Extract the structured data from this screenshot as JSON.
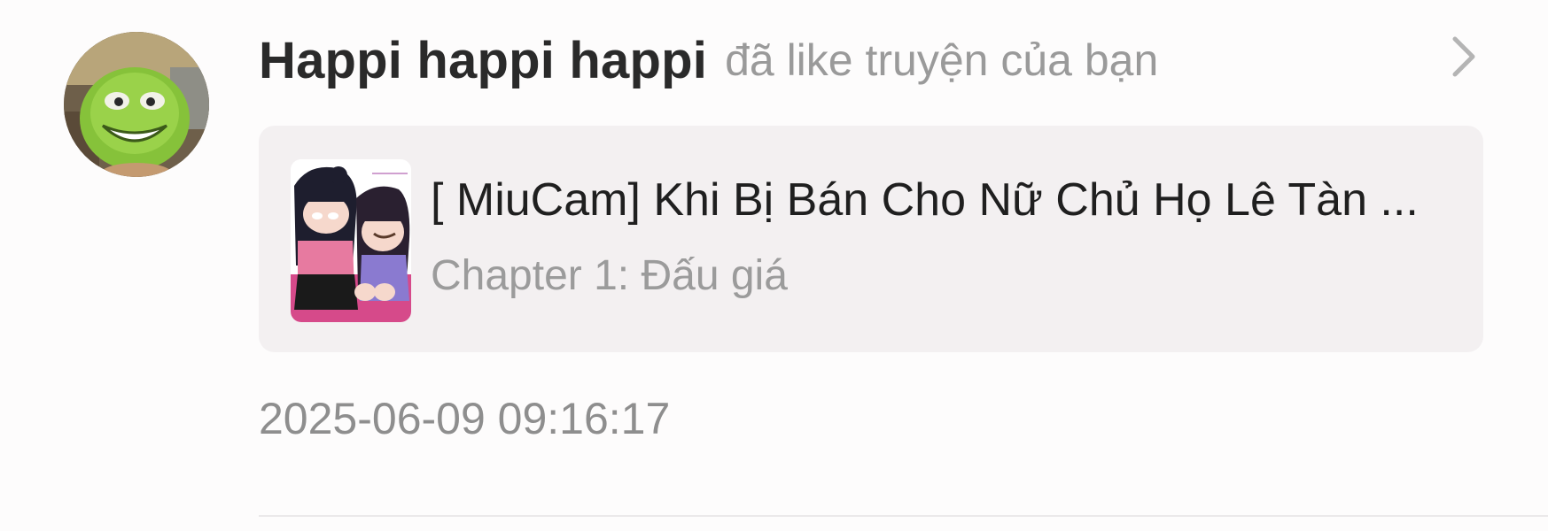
{
  "notification": {
    "username": "Happi happi happi",
    "action": "đã like truyện của bạn",
    "story": {
      "title": "[ MiuCam] Khi Bị Bán Cho Nữ Chủ Họ Lê Tàn ...",
      "chapter": "Chapter 1: Đấu giá"
    },
    "timestamp": "2025-06-09 09:16:17"
  },
  "icons": {
    "avatar": "green-one-eyed-monster-avatar",
    "open": "chevron-right-icon"
  },
  "colors": {
    "card_background": "#f3f0f1",
    "secondary_text": "#9a9a9a",
    "primary_text": "#2a2a2a"
  }
}
